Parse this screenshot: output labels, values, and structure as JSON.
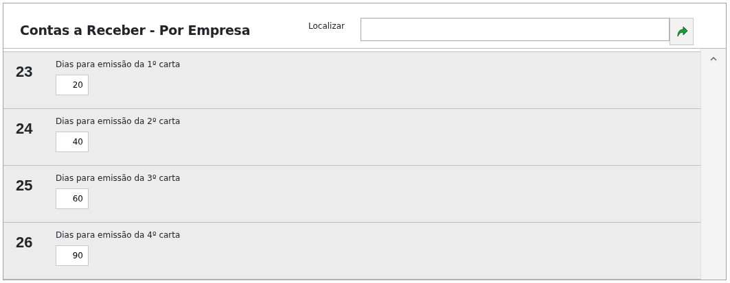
{
  "header": {
    "title": "Contas a Receber - Por Empresa",
    "search": {
      "label": "Localizar"
    }
  },
  "items": [
    {
      "number": "23",
      "label": "Dias para emissão da 1º carta",
      "value": "20"
    },
    {
      "number": "24",
      "label": "Dias para emissão da 2º carta",
      "value": "40"
    },
    {
      "number": "25",
      "label": "Dias para emissão da 3º carta",
      "value": "60"
    },
    {
      "number": "26",
      "label": "Dias para emissão da 4º carta",
      "value": "90"
    }
  ]
}
